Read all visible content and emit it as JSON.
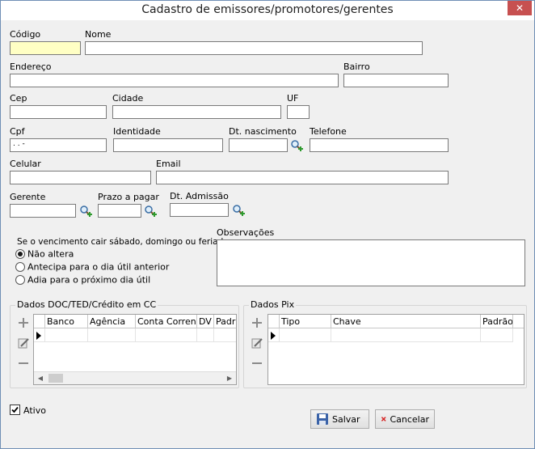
{
  "window": {
    "title": "Cadastro de emissores/promotores/gerentes",
    "close_glyph": "✕"
  },
  "labels": {
    "codigo": "Código",
    "nome": "Nome",
    "endereco": "Endereço",
    "bairro": "Bairro",
    "cep": "Cep",
    "cidade": "Cidade",
    "uf": "UF",
    "cpf": "Cpf",
    "identidade": "Identidade",
    "dt_nascimento": "Dt. nascimento",
    "telefone": "Telefone",
    "celular": "Celular",
    "email": "Email",
    "gerente": "Gerente",
    "prazo_pagar": "Prazo a pagar",
    "dt_admissao": "Dt. Admissão",
    "observacoes": "Observações"
  },
  "fields": {
    "codigo": "",
    "nome": "",
    "endereco": "",
    "bairro": "",
    "cep": "",
    "cidade": "",
    "uf": "",
    "cpf": " .  .  -",
    "identidade": "",
    "dt_nascimento": "",
    "telefone": "",
    "celular": "",
    "email": "",
    "gerente": "",
    "prazo_pagar": "",
    "dt_admissao": "",
    "observacoes": ""
  },
  "vencimento": {
    "title": "Se o vencimento cair sábado, domingo ou feriado",
    "options": [
      {
        "label": "Não altera",
        "selected": true
      },
      {
        "label": "Antecipa para o dia útil anterior",
        "selected": false
      },
      {
        "label": "Adia para o próximo dia útil",
        "selected": false
      }
    ]
  },
  "dados_doc": {
    "title": "Dados DOC/TED/Crédito em CC",
    "columns": [
      "Banco",
      "Agência",
      "Conta Corrente",
      "DV",
      "Padrão"
    ]
  },
  "dados_pix": {
    "title": "Dados Pix",
    "columns": [
      "Tipo",
      "Chave",
      "Padrão"
    ]
  },
  "ativo": {
    "label": "Ativo",
    "checked": true
  },
  "buttons": {
    "salvar": "Salvar",
    "cancelar": "Cancelar"
  },
  "icons": [
    "close-icon",
    "lookup-icon",
    "add-icon",
    "edit-icon",
    "remove-icon",
    "save-icon",
    "cancel-icon",
    "row-indicator-icon"
  ],
  "colors": {
    "required_field": "#ffffc4",
    "close_button": "#c75050"
  }
}
